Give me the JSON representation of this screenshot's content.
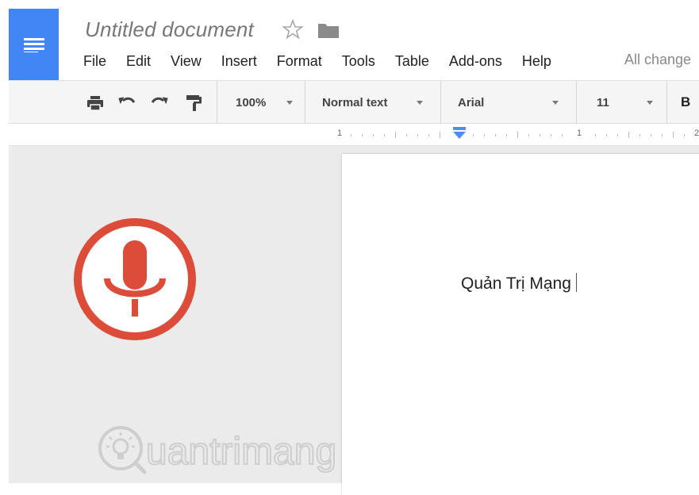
{
  "app": {
    "logo_icon": "docs-lines-icon",
    "brand_color": "#4285f4"
  },
  "document": {
    "title": "Untitled document",
    "star_icon": "star-outline-icon",
    "folder_icon": "folder-icon",
    "body_text": "Quản Trị Mạng"
  },
  "menu": {
    "items": [
      "File",
      "Edit",
      "View",
      "Insert",
      "Format",
      "Tools",
      "Table",
      "Add-ons",
      "Help"
    ],
    "save_status": "All change"
  },
  "toolbar": {
    "zoom": "100%",
    "style": "Normal text",
    "font": "Arial",
    "font_size": "11",
    "bold_label": "B",
    "icons": [
      "print-icon",
      "undo-icon",
      "redo-icon",
      "paint-format-icon"
    ]
  },
  "ruler": {
    "labels": [
      "1",
      "1",
      "2"
    ],
    "indent_marker_color": "#4d8ef0"
  },
  "voice_typing": {
    "icon": "microphone-icon",
    "color": "#dd4b39"
  },
  "watermark": {
    "text": "uantrimang",
    "color": "#c9c9c9"
  }
}
